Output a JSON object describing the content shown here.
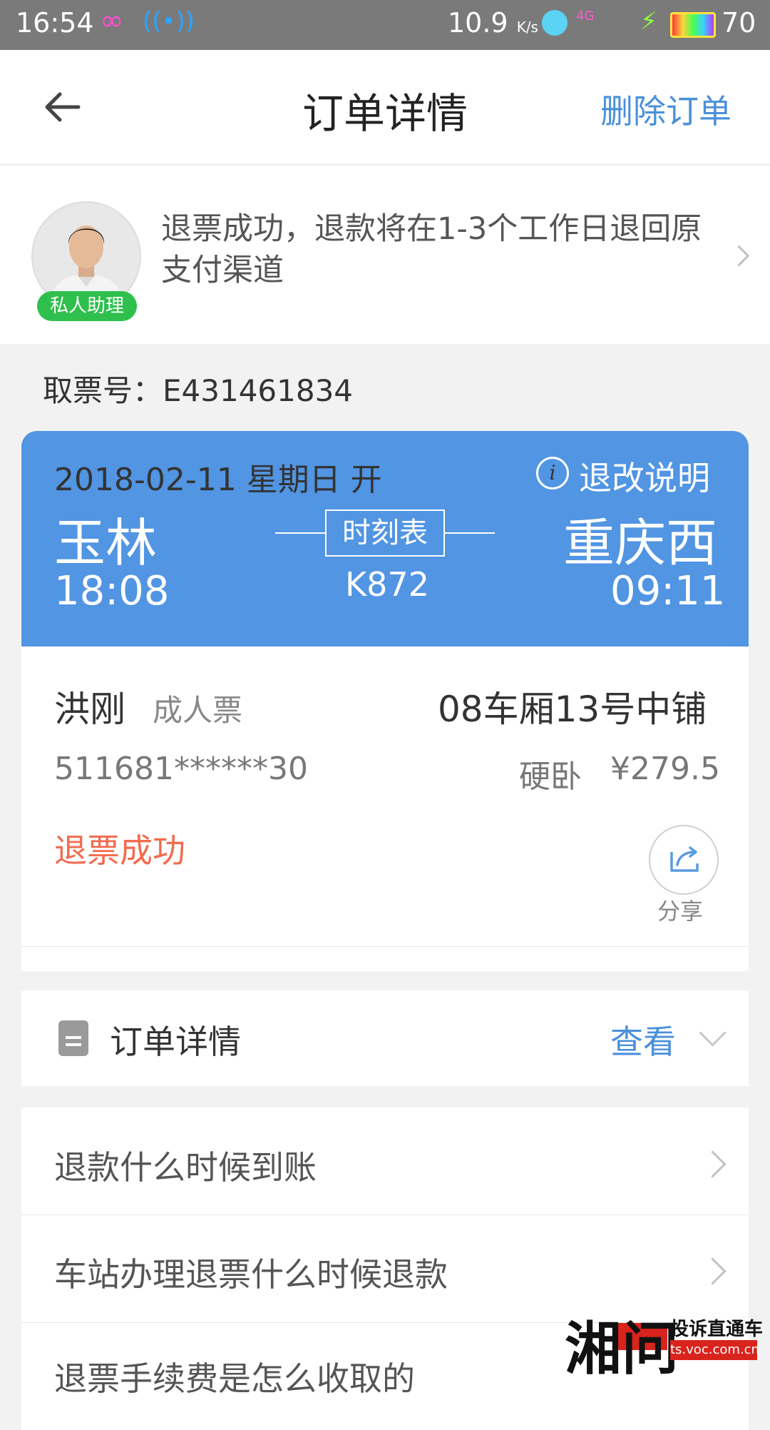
{
  "status_bar": {
    "time": "16:54",
    "infinity": "∞",
    "net_speed": "10.9",
    "speed_unit": "K/s",
    "network": "4G",
    "battery": "70"
  },
  "header": {
    "title": "订单详情",
    "delete_label": "删除订单"
  },
  "assistant": {
    "badge": "私人助理",
    "message": "退票成功，退款将在1-3个工作日退回原支付渠道"
  },
  "ticket_no": "取票号：E431461834",
  "journey": {
    "date": "2018-02-11 星期日 开",
    "rules_label": "退改说明",
    "info_glyph": "i",
    "from_station": "玉林",
    "to_station": "重庆西",
    "timetable_label": "时刻表",
    "train_no": "K872",
    "depart_time": "18:08",
    "arrive_time": "09:11"
  },
  "passenger": {
    "name": "洪刚",
    "ticket_type": "成人票",
    "seat": "08车厢13号中铺",
    "id_number": "511681******30",
    "seat_class": "硬卧",
    "price": "¥279.5",
    "status": "退票成功",
    "share_label": "分享"
  },
  "order_detail": {
    "label": "订单详情",
    "view_label": "查看"
  },
  "faq": [
    "退款什么时候到账",
    "车站办理退票什么时候退款",
    "退票手续费是怎么收取的"
  ],
  "watermark": {
    "logo": "湘问",
    "text": "投诉直通车",
    "url": "ts.voc.com.cn"
  },
  "colors": {
    "accent_blue": "#4a90d9",
    "card_blue": "#5195e3",
    "status_red": "#f26b4e",
    "badge_green": "#2fbf4d"
  }
}
